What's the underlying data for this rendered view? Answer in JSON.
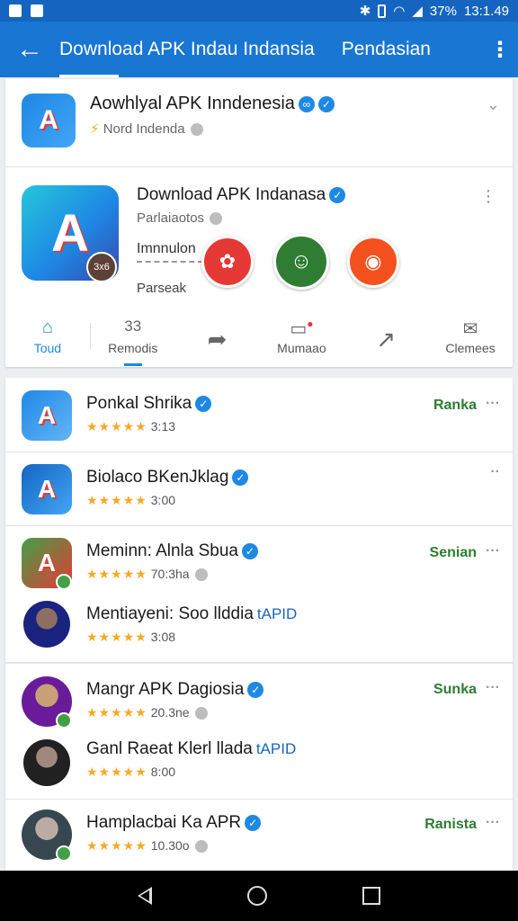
{
  "status_bar": {
    "battery": "37%",
    "time": "13:1.49"
  },
  "app_bar": {
    "title": "Download APK Indau Indansia",
    "tab2": "Pendasian"
  },
  "header": {
    "title": "Aowhlyal APK Inndenesia",
    "subtitle": "Nord Indenda"
  },
  "detail": {
    "title": "Download APK Indanasa",
    "subtitle": "Parlaiaotos",
    "label1": "Imnnulon",
    "label2": "Parseak",
    "logo_badge": "3x6"
  },
  "actions": [
    {
      "label": "Toud"
    },
    {
      "top": "33",
      "label": "Remodis"
    },
    {
      "label": ""
    },
    {
      "label": "Mumaao"
    },
    {
      "label": ""
    },
    {
      "label": "Clemees"
    }
  ],
  "list": [
    {
      "name": "Ponkal Shrika",
      "rating": "3:13",
      "status": "Ranka"
    },
    {
      "name": "Biolaco BKenJklag",
      "rating": "3:00",
      "status": ""
    },
    {
      "name": "Meminn: Alnla Sbua",
      "rating": "70:3ha",
      "status": "Senian"
    },
    {
      "name": "Mentiayeni: Soo llddia",
      "tag": "tAPID",
      "rating": "3:08",
      "status": ""
    },
    {
      "name": "Mangr APK Dagiosia",
      "rating": "20.3ne",
      "status": "Sunka"
    },
    {
      "name": "Ganl Raeat Klerl llada",
      "tag": "tAPID",
      "rating": "8:00",
      "status": ""
    },
    {
      "name": "Hamplacbai Ka APR",
      "rating": "10.30o",
      "status": "Ranista"
    }
  ]
}
